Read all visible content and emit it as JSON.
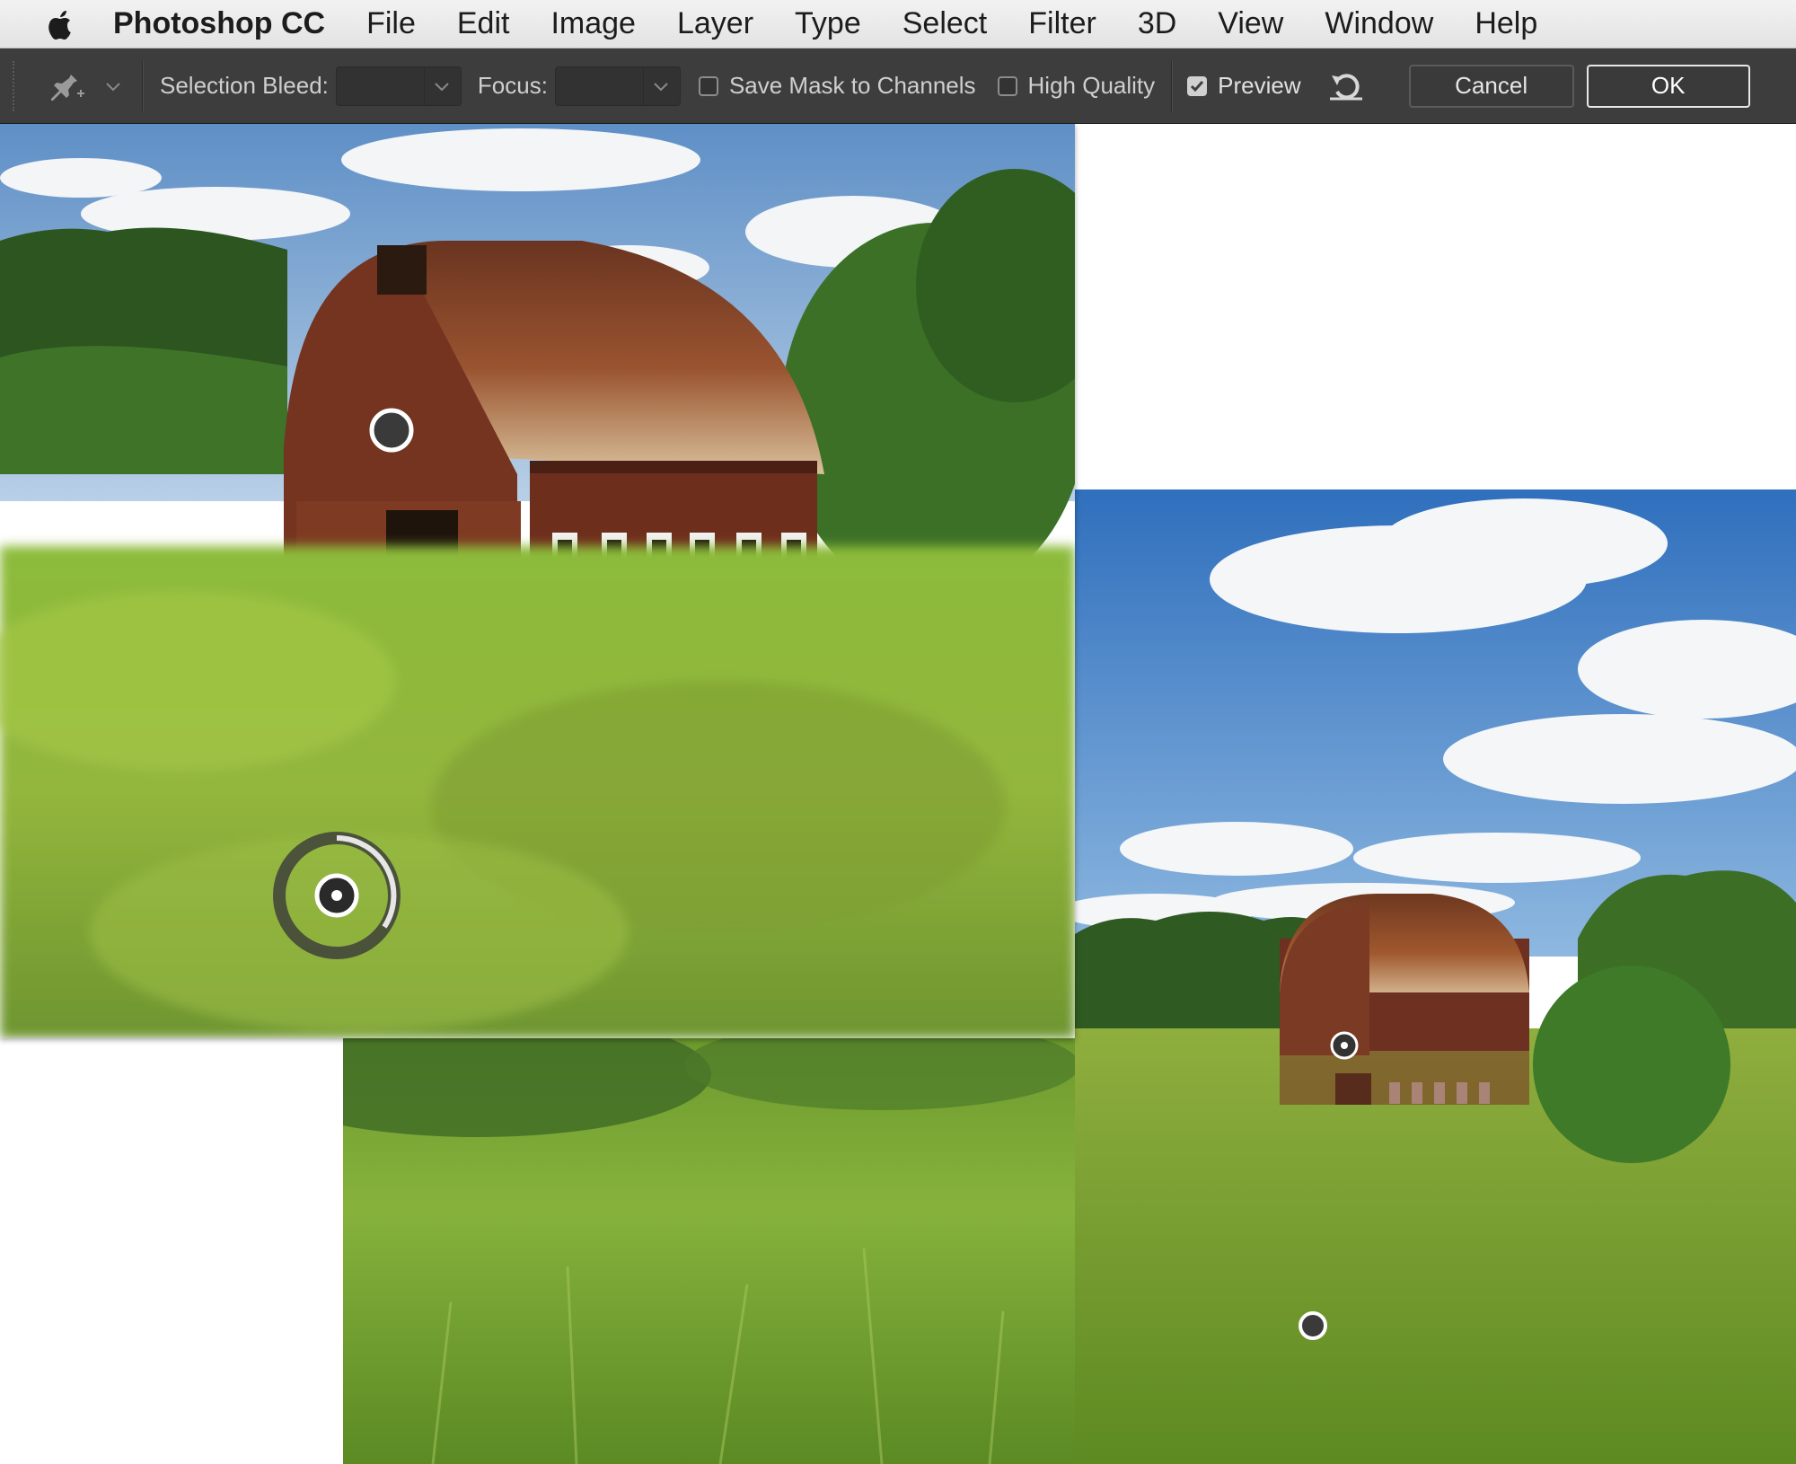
{
  "menubar": {
    "app_name": "Photoshop CC",
    "items": [
      "File",
      "Edit",
      "Image",
      "Layer",
      "Type",
      "Select",
      "Filter",
      "3D",
      "View",
      "Window",
      "Help"
    ]
  },
  "options_bar": {
    "tool_icon": "pin-icon",
    "selection_bleed_label": "Selection Bleed:",
    "selection_bleed_value": "",
    "focus_label": "Focus:",
    "focus_value": "",
    "save_mask_label": "Save Mask to Channels",
    "save_mask_checked": false,
    "high_quality_label": "High Quality",
    "high_quality_checked": false,
    "preview_label": "Preview",
    "preview_checked": true,
    "reset_icon": "reset-icon",
    "cancel_label": "Cancel",
    "ok_label": "OK"
  },
  "colors": {
    "menubar_bg": "#e8e8e8",
    "optbar_bg": "#3d3d3d",
    "sky": "#3f7fc6",
    "grass": "#7aa632",
    "barn_wall": "#7a3a24",
    "barn_roof": "#8a4a26"
  },
  "canvas": {
    "panels": [
      "photo-focus-barn-blurred-foreground",
      "photo-full-scene",
      "photo-foreground-grass"
    ],
    "pins": [
      "blur-pin-barn",
      "blur-pin-grass-active",
      "blur-pin-barn-small",
      "blur-pin-grass-small"
    ]
  }
}
